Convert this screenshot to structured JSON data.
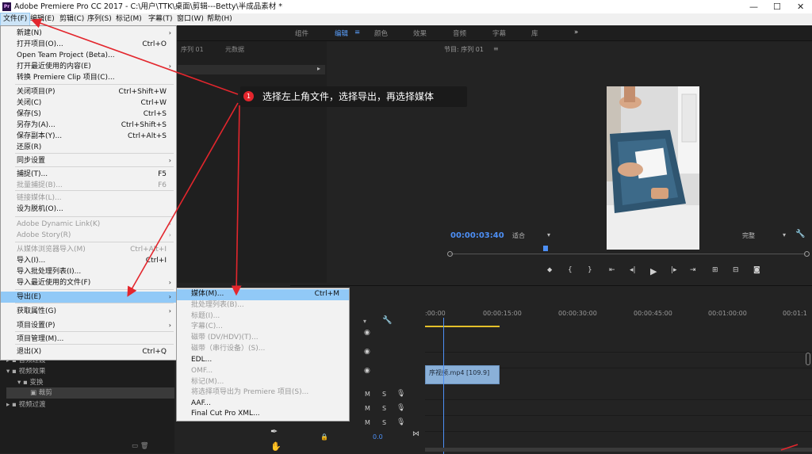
{
  "window": {
    "title": "Adobe Premiere Pro CC 2017 - C:\\用户\\TTK\\桌面\\剪辑---Betty\\半成品素材 *",
    "app_badge": "Pr"
  },
  "menubar": [
    "文件(F)",
    "编辑(E)",
    "剪辑(C)",
    "序列(S)",
    "标记(M)",
    "字幕(T)",
    "窗口(W)",
    "帮助(H)"
  ],
  "workspace_tabs": [
    "组件",
    "编辑",
    "颜色",
    "效果",
    "音频",
    "字幕",
    "库"
  ],
  "workspace_more": "»",
  "source_panel": {
    "tabs": [
      "序列 01",
      "元数据"
    ]
  },
  "program_panel": {
    "title": "节目: 序列 01",
    "timecode": "00:00:03:40",
    "fit": "适合",
    "quality": "完整"
  },
  "timeline": {
    "ruler": [
      ":00:00",
      "00:00:15:00",
      "00:00:30:00",
      "00:00:45:00",
      "00:01:00:00",
      "00:01:1"
    ],
    "clip": "序视频.mp4 [109.9]",
    "volume": "0.0"
  },
  "project_panel": {
    "items": [
      "音频过渡",
      "视频效果",
      "变换",
      "裁剪",
      "视频过渡"
    ]
  },
  "file_menu": {
    "items": [
      {
        "label": "新建(N)",
        "shortcut": "",
        "arrow": true,
        "disabled": false
      },
      {
        "label": "打开项目(O)...",
        "shortcut": "Ctrl+O",
        "arrow": false,
        "disabled": false
      },
      {
        "label": "Open Team Project (Beta)...",
        "shortcut": "",
        "arrow": false,
        "disabled": false
      },
      {
        "label": "打开最近使用的内容(E)",
        "shortcut": "",
        "arrow": true,
        "disabled": false
      },
      {
        "label": "转换 Premiere Clip 项目(C)...",
        "shortcut": "",
        "arrow": false,
        "disabled": false
      },
      {
        "label": "关闭项目(P)",
        "shortcut": "Ctrl+Shift+W",
        "arrow": false,
        "disabled": false
      },
      {
        "label": "关闭(C)",
        "shortcut": "Ctrl+W",
        "arrow": false,
        "disabled": false
      },
      {
        "label": "保存(S)",
        "shortcut": "Ctrl+S",
        "arrow": false,
        "disabled": false
      },
      {
        "label": "另存为(A)...",
        "shortcut": "Ctrl+Shift+S",
        "arrow": false,
        "disabled": false
      },
      {
        "label": "保存副本(Y)...",
        "shortcut": "Ctrl+Alt+S",
        "arrow": false,
        "disabled": false
      },
      {
        "label": "还原(R)",
        "shortcut": "",
        "arrow": false,
        "disabled": false
      },
      {
        "label": "同步设置",
        "shortcut": "",
        "arrow": true,
        "disabled": false
      },
      {
        "label": "捕捉(T)...",
        "shortcut": "F5",
        "arrow": false,
        "disabled": false
      },
      {
        "label": "批量捕捉(B)...",
        "shortcut": "F6",
        "arrow": false,
        "disabled": true
      },
      {
        "label": "链接媒体(L)...",
        "shortcut": "",
        "arrow": false,
        "disabled": true
      },
      {
        "label": "设为脱机(O)...",
        "shortcut": "",
        "arrow": false,
        "disabled": false
      },
      {
        "label": "Adobe Dynamic Link(K)",
        "shortcut": "",
        "arrow": true,
        "disabled": true
      },
      {
        "label": "Adobe Story(R)",
        "shortcut": "",
        "arrow": true,
        "disabled": true
      },
      {
        "label": "从媒体浏览器导入(M)",
        "shortcut": "Ctrl+Alt+I",
        "arrow": false,
        "disabled": true
      },
      {
        "label": "导入(I)...",
        "shortcut": "Ctrl+I",
        "arrow": false,
        "disabled": false
      },
      {
        "label": "导入批处理列表(I)...",
        "shortcut": "",
        "arrow": false,
        "disabled": false
      },
      {
        "label": "导入最近使用的文件(F)",
        "shortcut": "",
        "arrow": true,
        "disabled": false
      },
      {
        "label": "导出(E)",
        "shortcut": "",
        "arrow": true,
        "disabled": false
      },
      {
        "label": "获取属性(G)",
        "shortcut": "",
        "arrow": true,
        "disabled": false
      },
      {
        "label": "项目设置(P)",
        "shortcut": "",
        "arrow": true,
        "disabled": false
      },
      {
        "label": "项目管理(M)...",
        "shortcut": "",
        "arrow": false,
        "disabled": false
      },
      {
        "label": "退出(X)",
        "shortcut": "Ctrl+Q",
        "arrow": false,
        "disabled": false
      }
    ]
  },
  "export_menu": {
    "items": [
      {
        "label": "媒体(M)...",
        "shortcut": "Ctrl+M",
        "disabled": false
      },
      {
        "label": "批处理列表(B)...",
        "shortcut": "",
        "disabled": true
      },
      {
        "label": "标题(I)...",
        "shortcut": "",
        "disabled": true
      },
      {
        "label": "字幕(C)...",
        "shortcut": "",
        "disabled": true
      },
      {
        "label": "磁带 (DV/HDV)(T)...",
        "shortcut": "",
        "disabled": true
      },
      {
        "label": "磁带（串行设备）(S)...",
        "shortcut": "",
        "disabled": true
      },
      {
        "label": "EDL...",
        "shortcut": "",
        "disabled": false
      },
      {
        "label": "OMF...",
        "shortcut": "",
        "disabled": true
      },
      {
        "label": "标记(M)...",
        "shortcut": "",
        "disabled": true
      },
      {
        "label": "将选择项导出为 Premiere 项目(S)...",
        "shortcut": "",
        "disabled": true
      },
      {
        "label": "AAF...",
        "shortcut": "",
        "disabled": false
      },
      {
        "label": "Final Cut Pro XML...",
        "shortcut": "",
        "disabled": false
      }
    ]
  },
  "callout": {
    "number": "1",
    "text": "选择左上角文件，选择导出，再选择媒体"
  },
  "accent": "#4d8ff5",
  "menu_highlight": "#91c9f7",
  "arrow_color": "#e3262d"
}
